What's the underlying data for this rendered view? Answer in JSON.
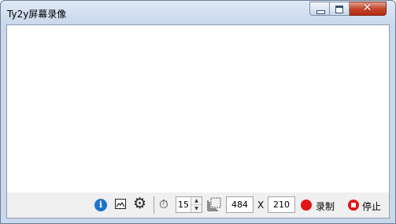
{
  "window": {
    "title": "Ty2y屏幕录像"
  },
  "titlebar": {
    "minimize_icon": "minimize-icon",
    "maximize_icon": "maximize-icon",
    "close_glyph": "✕"
  },
  "toolbar": {
    "info_icon": "info-icon",
    "info_glyph": "i",
    "screenshot_icon": "image-icon",
    "settings_icon": "gear-icon",
    "settings_glyph": "⚙",
    "timer_icon": "stopwatch-icon",
    "timer_glyph": "⏱",
    "fps_value": "15",
    "spin_up": "▲",
    "spin_down": "▼",
    "size_icon": "resize-icon",
    "width_value": "484",
    "x_label": "X",
    "height_value": "210",
    "record_label": "录制",
    "stop_label": "停止",
    "record_color": "#e01515"
  }
}
